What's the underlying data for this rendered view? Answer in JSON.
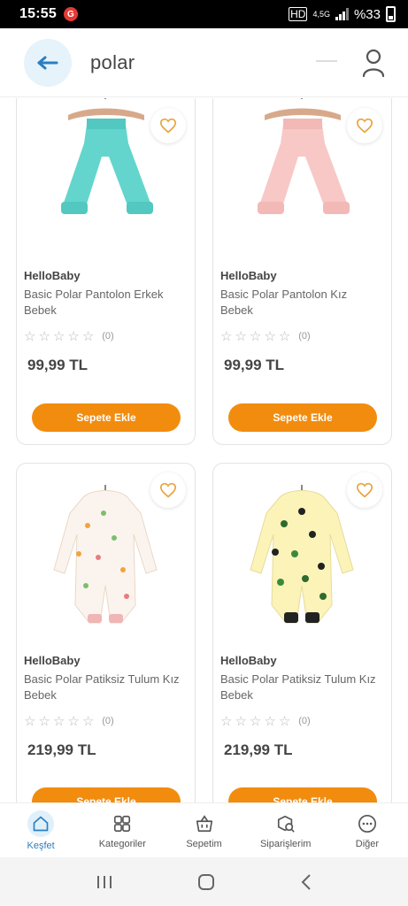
{
  "status": {
    "time": "15:55",
    "battery": "%33",
    "network": "4,5G"
  },
  "header": {
    "search_query": "polar"
  },
  "products": [
    {
      "brand": "HelloBaby",
      "name": "Basic Polar Pantolon Erkek Bebek",
      "rating_count": "(0)",
      "price": "99,99 TL",
      "cart_label": "Sepete Ekle"
    },
    {
      "brand": "HelloBaby",
      "name": "Basic Polar Pantolon Kız Bebek",
      "rating_count": "(0)",
      "price": "99,99 TL",
      "cart_label": "Sepete Ekle"
    },
    {
      "brand": "HelloBaby",
      "name": "Basic Polar Patiksiz Tulum Kız Bebek",
      "rating_count": "(0)",
      "price": "219,99 TL",
      "cart_label": "Sepete Ekle"
    },
    {
      "brand": "HelloBaby",
      "name": "Basic Polar Patiksiz Tulum Kız Bebek",
      "rating_count": "(0)",
      "price": "219,99 TL",
      "cart_label": "Sepete Ekle"
    }
  ],
  "bottom_nav": [
    {
      "label": "Keşfet",
      "icon": "home-icon",
      "active": true
    },
    {
      "label": "Kategoriler",
      "icon": "grid-icon",
      "active": false
    },
    {
      "label": "Sepetim",
      "icon": "basket-icon",
      "active": false
    },
    {
      "label": "Siparişlerim",
      "icon": "orders-icon",
      "active": false
    },
    {
      "label": "Diğer",
      "icon": "more-icon",
      "active": false
    }
  ],
  "colors": {
    "accent": "#f28c0f",
    "primary": "#2a7fc1",
    "heart": "#e8a33c"
  }
}
